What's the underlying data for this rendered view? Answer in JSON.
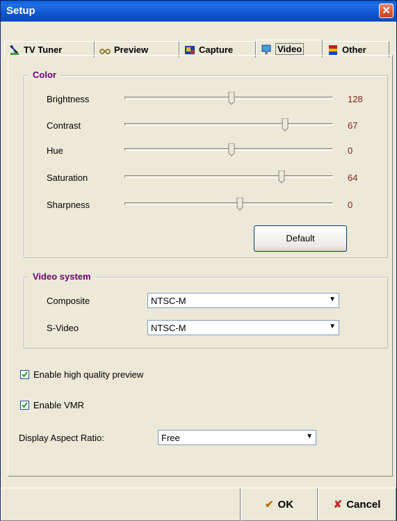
{
  "window": {
    "title": "Setup",
    "close_icon": "close-icon"
  },
  "tabs": [
    {
      "label": "TV Tuner",
      "icon": "antenna-icon"
    },
    {
      "label": "Preview",
      "icon": "glasses-icon"
    },
    {
      "label": "Capture",
      "icon": "capture-icon"
    },
    {
      "label": "Video",
      "icon": "monitor-icon",
      "active": true
    },
    {
      "label": "Other",
      "icon": "other-icon"
    }
  ],
  "color_group": {
    "title": "Color",
    "sliders": [
      {
        "label": "Brightness",
        "value": "128",
        "level": 0.5
      },
      {
        "label": "Contrast",
        "value": "67",
        "level": 0.76
      },
      {
        "label": "Hue",
        "value": "0",
        "level": 0.5
      },
      {
        "label": "Saturation",
        "value": "64",
        "level": 0.74
      },
      {
        "label": "Sharpness",
        "value": "0",
        "level": 0.54
      }
    ],
    "default_button": "Default"
  },
  "video_system": {
    "title": "Video system",
    "rows": [
      {
        "label": "Composite",
        "value": "NTSC-M"
      },
      {
        "label": "S-Video",
        "value": "NTSC-M"
      }
    ]
  },
  "options": {
    "hq_preview": {
      "label": "Enable high quality preview",
      "checked": true
    },
    "vmr": {
      "label": "Enable VMR",
      "checked": true
    },
    "aspect": {
      "label": "Display Aspect Ratio:",
      "value": "Free"
    }
  },
  "footer": {
    "ok": "OK",
    "cancel": "Cancel"
  },
  "colors": {
    "accent_title": "#6b0070",
    "value_text": "#8b1a1a",
    "titlebar": "#1256d0"
  }
}
